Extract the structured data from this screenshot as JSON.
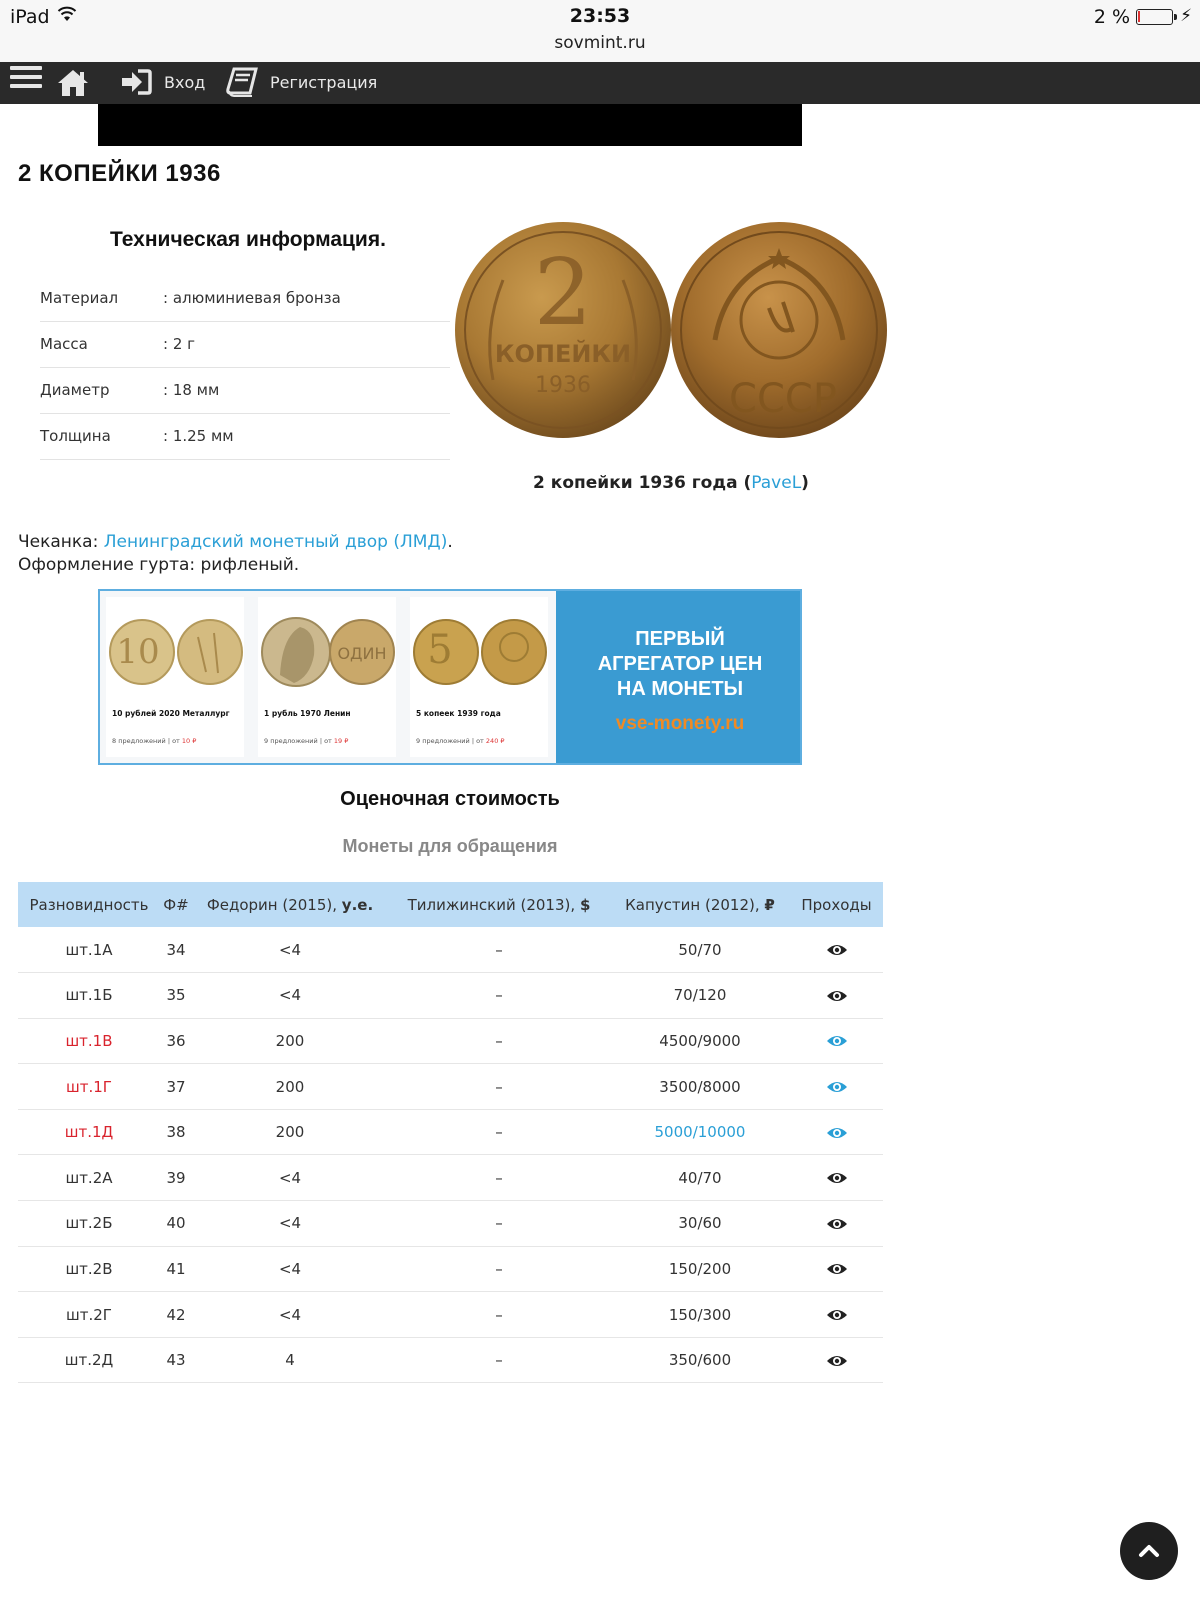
{
  "statusbar": {
    "device": "iPad",
    "time": "23:53",
    "url": "sovmint.ru",
    "battery": "2 %"
  },
  "nav": {
    "login_label": "Вход",
    "register_label": "Регистрация"
  },
  "page_title": "2 КОПЕЙКИ 1936",
  "tech": {
    "heading": "Техническая информация.",
    "rows": [
      {
        "key": "Материал",
        "value": ": алюминиевая бронза"
      },
      {
        "key": "Масса",
        "value": ": 2 г"
      },
      {
        "key": "Диаметр",
        "value": ": 18 мм"
      },
      {
        "key": "Толщина",
        "value": ": 1.25 мм"
      }
    ]
  },
  "coin_image": {
    "obverse_text": [
      "2",
      "КОПЕЙКИ",
      "1936"
    ],
    "reverse_text": "СССР",
    "caption": "2 копейки 1936 года",
    "caption_author": "PaveL"
  },
  "minting": {
    "label": "Чеканка:",
    "value": "Ленинградский монетный двор (ЛМД)",
    "suffix": "."
  },
  "edge": "Оформление гурта: рифленый.",
  "banner": {
    "cards": [
      {
        "name": "10 рублей 2020 Металлург",
        "offers": "8 предложений | от ",
        "price": "10 ₽"
      },
      {
        "name": "1 рубль 1970 Ленин",
        "offers": "9 предложений | от ",
        "price": "19 ₽"
      },
      {
        "name": "5 копеек 1939 года",
        "offers": "9 предложений | от ",
        "price": "240 ₽"
      }
    ],
    "headline": "ПЕРВЫЙ АГРЕГАТОР ЦЕН НА МОНЕТЫ",
    "site": "vse-monety.ru"
  },
  "estimate": {
    "heading": "Оценочная стоимость",
    "subheading": "Монеты для обращения"
  },
  "table": {
    "headers": {
      "variety": "Разновидность",
      "fnum": "Ф#",
      "fedorin": "Федорин (2015),",
      "fedorin_unit": "у.е.",
      "tilizhinsky": "Тилижинский (2013),",
      "tilizhinsky_unit": "$",
      "kapustin": "Капустин (2012),",
      "kapustin_unit": "₽",
      "passes": "Проходы"
    },
    "rows": [
      {
        "variety": "шт.1А",
        "fnum": "34",
        "fedorin": "<4",
        "tilizhinsky": "–",
        "kapustin": "50/70",
        "highlight": false,
        "price_link": false
      },
      {
        "variety": "шт.1Б",
        "fnum": "35",
        "fedorin": "<4",
        "tilizhinsky": "–",
        "kapustin": "70/120",
        "highlight": false,
        "price_link": false
      },
      {
        "variety": "шт.1В",
        "fnum": "36",
        "fedorin": "200",
        "tilizhinsky": "–",
        "kapustin": "4500/9000",
        "highlight": true,
        "price_link": false
      },
      {
        "variety": "шт.1Г",
        "fnum": "37",
        "fedorin": "200",
        "tilizhinsky": "–",
        "kapustin": "3500/8000",
        "highlight": true,
        "price_link": false
      },
      {
        "variety": "шт.1Д",
        "fnum": "38",
        "fedorin": "200",
        "tilizhinsky": "–",
        "kapustin": "5000/10000",
        "highlight": true,
        "price_link": true
      },
      {
        "variety": "шт.2А",
        "fnum": "39",
        "fedorin": "<4",
        "tilizhinsky": "–",
        "kapustin": "40/70",
        "highlight": false,
        "price_link": false
      },
      {
        "variety": "шт.2Б",
        "fnum": "40",
        "fedorin": "<4",
        "tilizhinsky": "–",
        "kapustin": "30/60",
        "highlight": false,
        "price_link": false
      },
      {
        "variety": "шт.2В",
        "fnum": "41",
        "fedorin": "<4",
        "tilizhinsky": "–",
        "kapustin": "150/200",
        "highlight": false,
        "price_link": false
      },
      {
        "variety": "шт.2Г",
        "fnum": "42",
        "fedorin": "<4",
        "tilizhinsky": "–",
        "kapustin": "150/300",
        "highlight": false,
        "price_link": false
      },
      {
        "variety": "шт.2Д",
        "fnum": "43",
        "fedorin": "4",
        "tilizhinsky": "–",
        "kapustin": "350/600",
        "highlight": false,
        "price_link": false
      }
    ]
  },
  "colors": {
    "link": "#2a9fd6",
    "rare": "#d9232d",
    "header_bg": "#bcdcf5",
    "navbar": "#2a2a2a"
  },
  "icons": {
    "menu": "hamburger-icon",
    "home": "home-icon",
    "login": "sign-in-icon",
    "register": "book-icon",
    "passes": "eye-icon",
    "scroll_top": "chevron-up-icon"
  }
}
